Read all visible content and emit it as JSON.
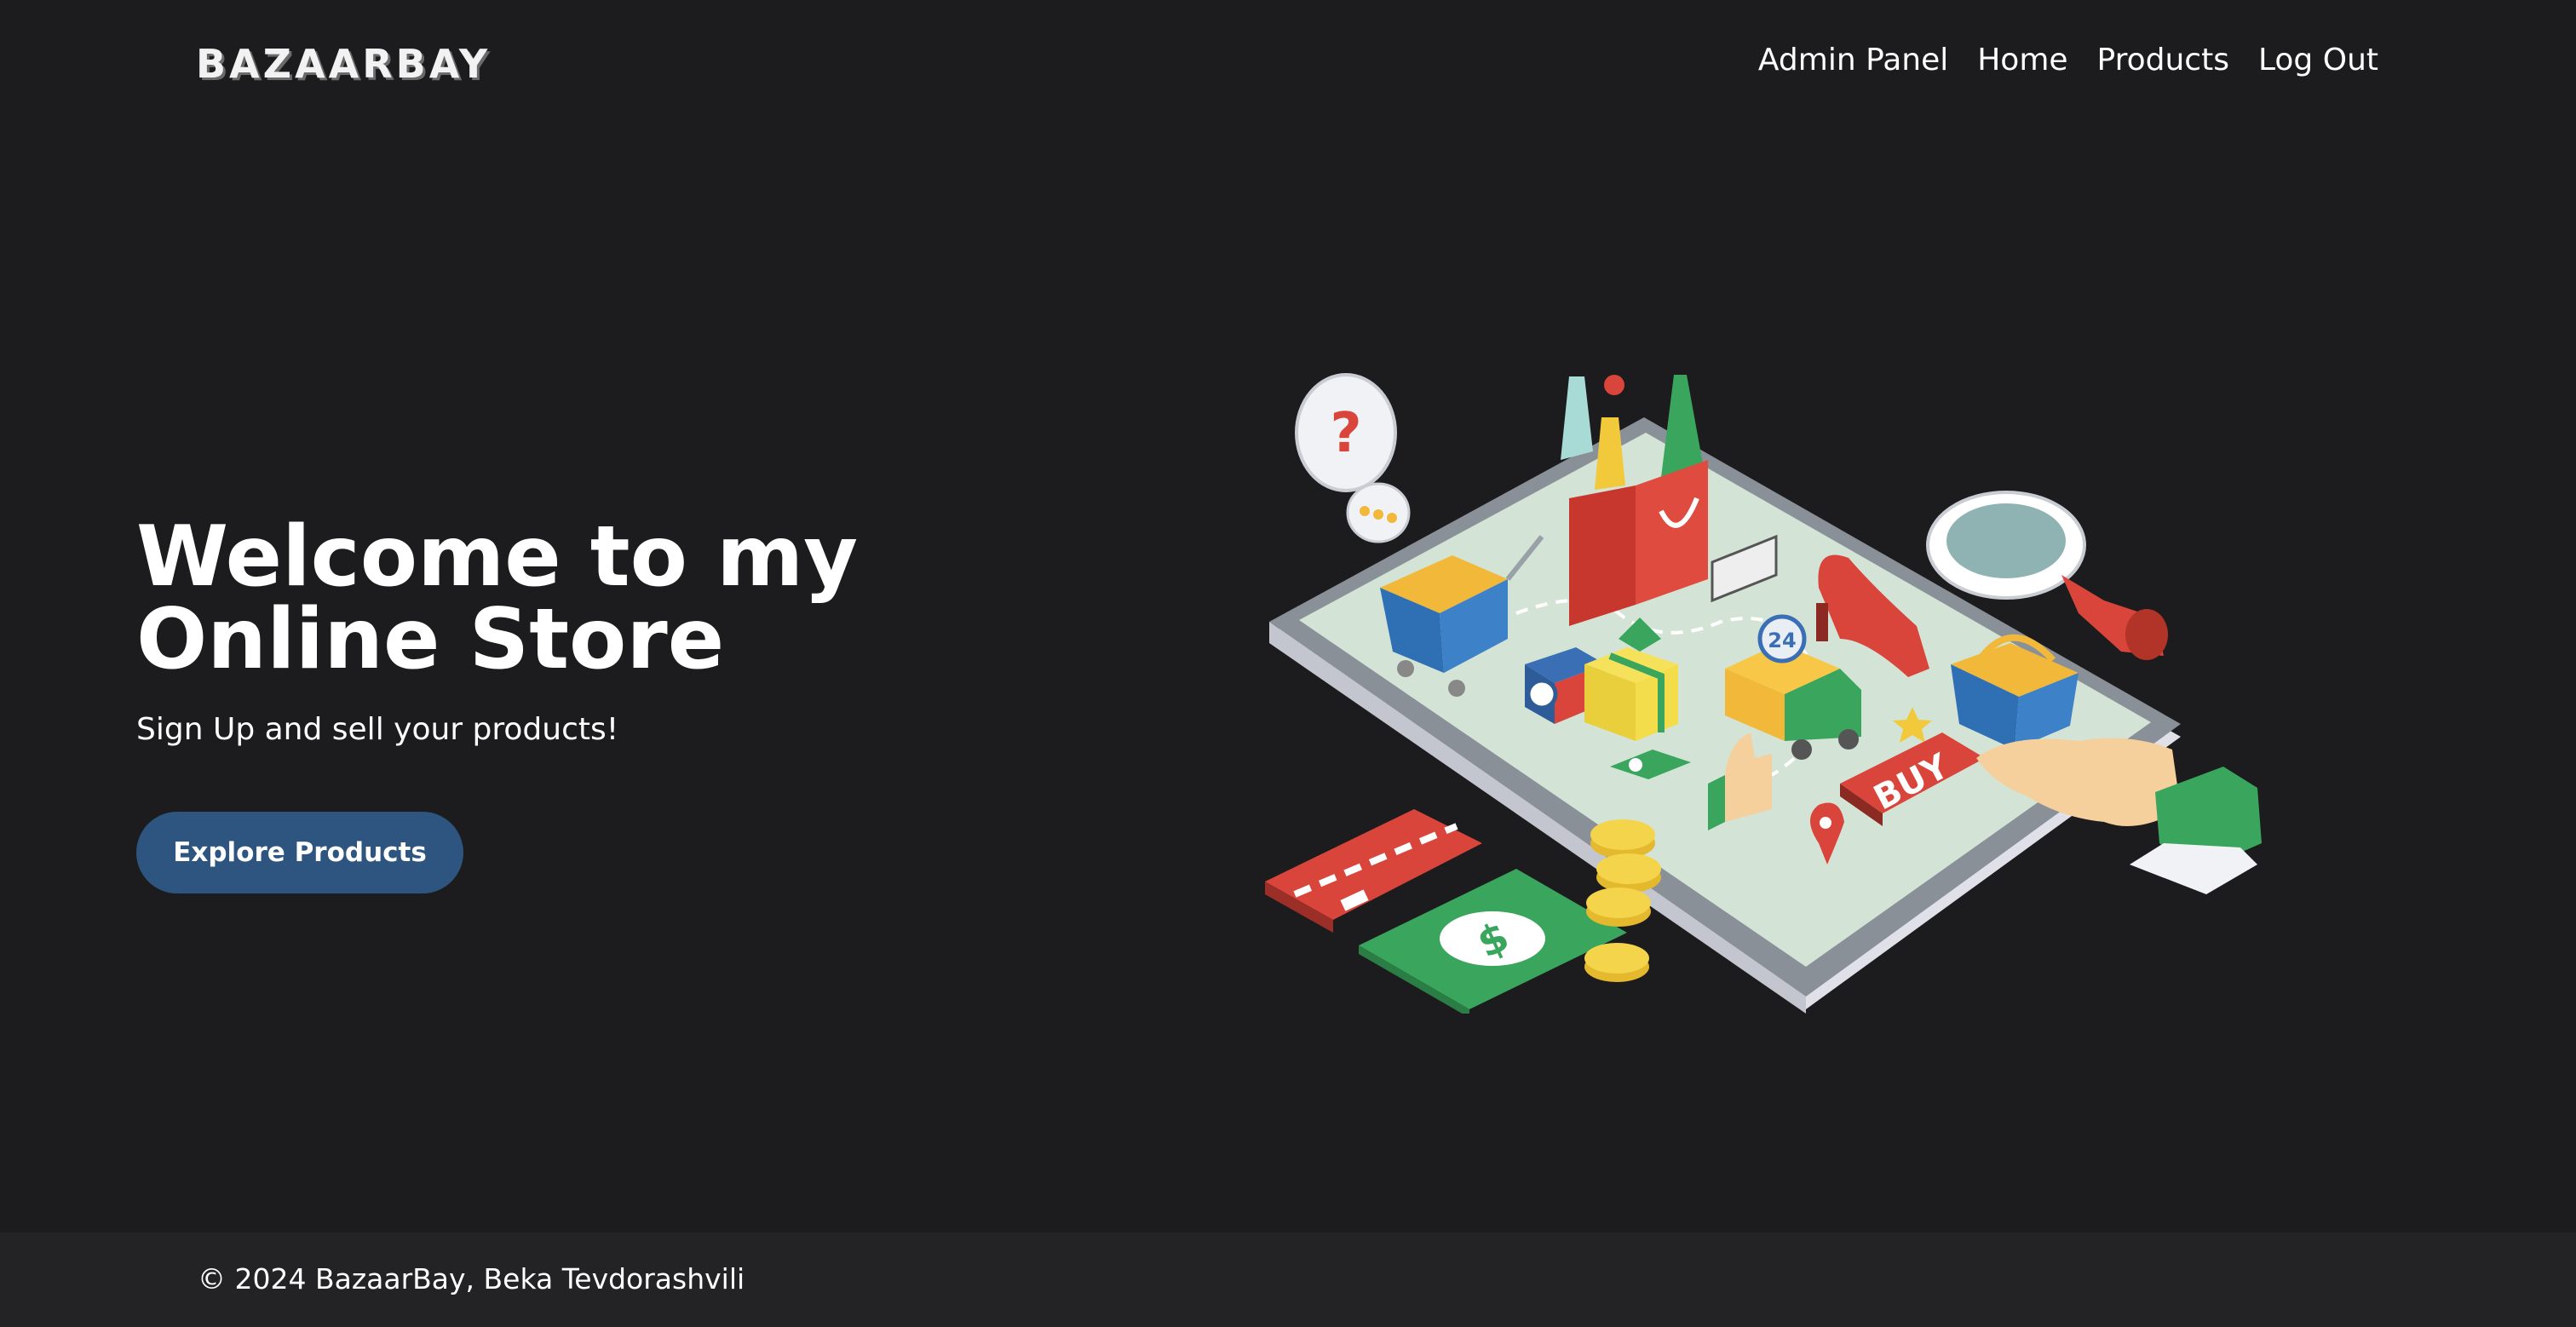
{
  "header": {
    "logo": "BAZAARBAY",
    "nav": [
      {
        "label": "Admin Panel"
      },
      {
        "label": "Home"
      },
      {
        "label": "Products"
      },
      {
        "label": "Log Out"
      }
    ]
  },
  "hero": {
    "title_line1": "Welcome to my",
    "title_line2": "Online Store",
    "subtitle": "Sign Up and sell your products!",
    "cta_label": "Explore Products",
    "illustration": {
      "sign_text": "BUY",
      "badge_text": "24",
      "question_mark": "?",
      "currency_symbol": "$"
    }
  },
  "footer": {
    "text": "© 2024 BazaarBay, Beka Tevdorashvili"
  },
  "colors": {
    "background": "#1c1c1e",
    "footer_bg": "#232225",
    "button": "#2d5580"
  }
}
